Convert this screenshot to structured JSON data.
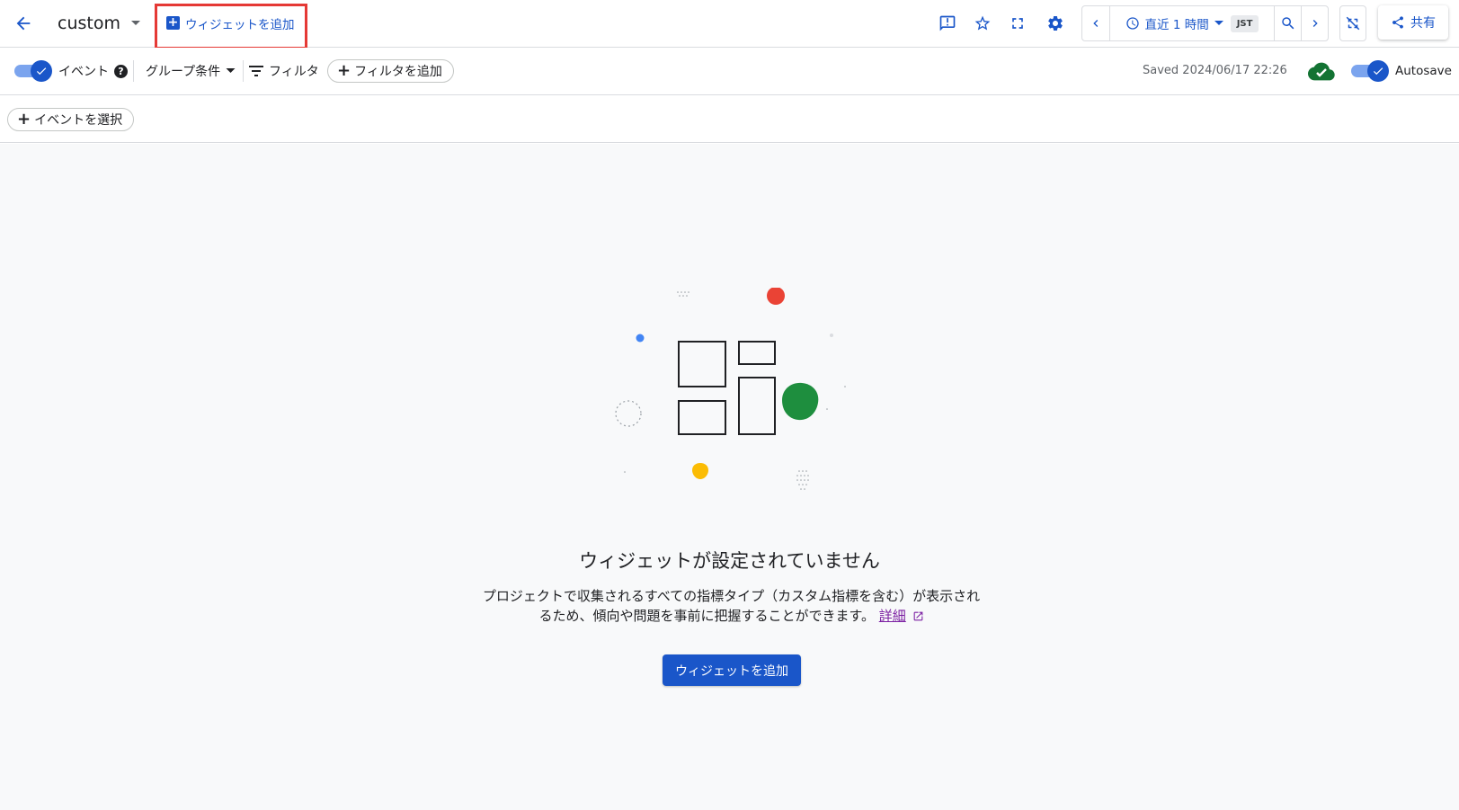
{
  "header": {
    "title": "custom",
    "add_widget_label": "ウィジェットを追加",
    "time_range": "直近 1 時間",
    "timezone": "JST",
    "share_label": "共有"
  },
  "filterbar": {
    "events_label": "イベント",
    "group_by_label": "グループ条件",
    "filter_label": "フィルタ",
    "add_filter_label": "フィルタを追加",
    "saved_text": "Saved 2024/06/17 22:26",
    "autosave_label": "Autosave"
  },
  "eventbar": {
    "select_event_label": "イベントを選択"
  },
  "empty_state": {
    "title": "ウィジェットが設定されていません",
    "description": "プロジェクトで収集されるすべての指標タイプ（カスタム指標を含む）が表示されるため、傾向や問題を事前に把握することができます。",
    "link_label": "詳細",
    "button_label": "ウィジェットを追加"
  },
  "colors": {
    "accent": "#1a56c9",
    "highlight_border": "#e53935",
    "cloud_saved": "#137333",
    "dot_red": "#ea4335",
    "dot_green": "#1e8e3e",
    "dot_yellow": "#fbbc04",
    "dot_blue": "#4285f4"
  },
  "icons": [
    "back-arrow-icon",
    "dropdown-caret-icon",
    "add-box-icon",
    "feedback-icon",
    "star-icon",
    "fullscreen-icon",
    "settings-icon",
    "chevron-left-icon",
    "clock-icon",
    "zoom-icon",
    "chevron-right-icon",
    "compare-off-icon",
    "share-icon",
    "filter-lines-icon",
    "help-icon",
    "cloud-done-icon",
    "external-link-icon"
  ]
}
